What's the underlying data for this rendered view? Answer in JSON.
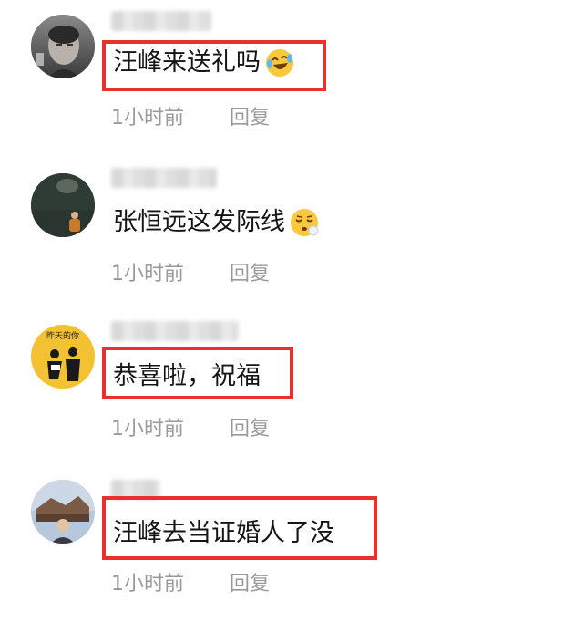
{
  "comments": [
    {
      "text": "汪峰来送礼吗",
      "emoji": "laughing-crying-emoji",
      "time": "1小时前",
      "reply": "回复",
      "highlighted": true
    },
    {
      "text": "张恒远这发际线",
      "emoji": "relieved-sigh-emoji",
      "time": "1小时前",
      "reply": "回复",
      "highlighted": false
    },
    {
      "text": "恭喜啦，祝福",
      "emoji": "",
      "time": "1小时前",
      "reply": "回复",
      "highlighted": true,
      "avatar_text": "昨天的你"
    },
    {
      "text": "汪峰去当证婚人了没",
      "emoji": "",
      "time": "1小时前",
      "reply": "回复",
      "highlighted": true
    }
  ],
  "colors": {
    "highlight": "#e8302e",
    "meta": "#9a9a9a",
    "text": "#151515"
  }
}
